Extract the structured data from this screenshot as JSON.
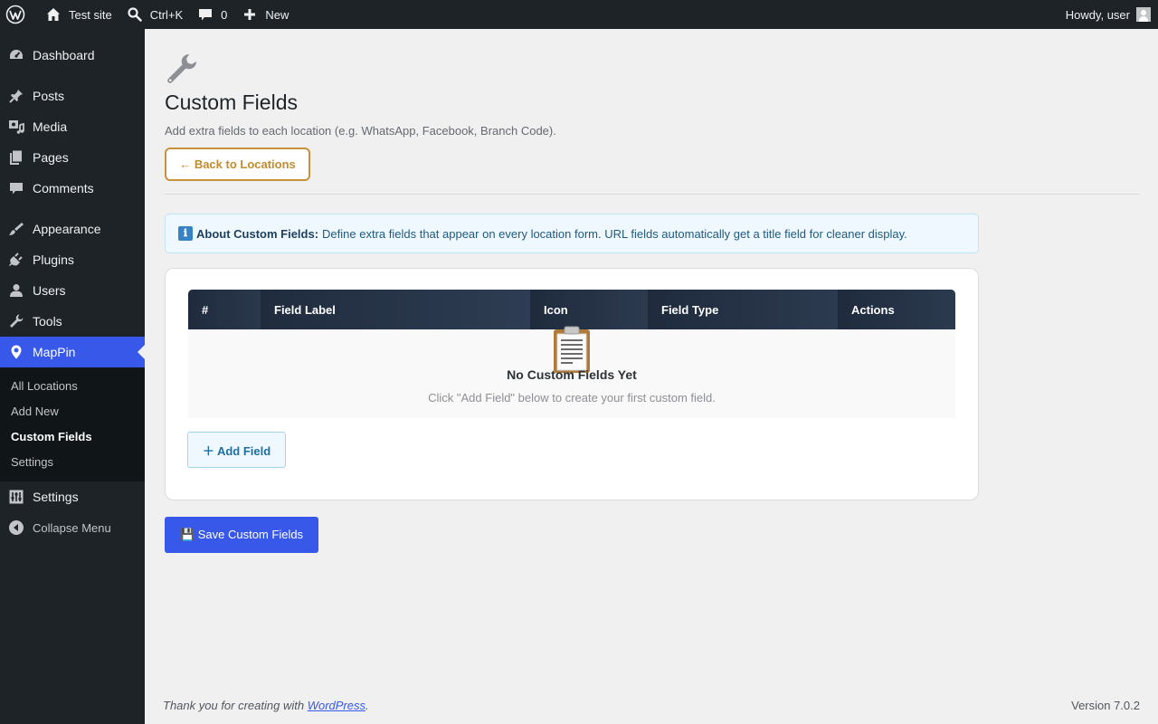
{
  "adminbar": {
    "site_name": "Test site",
    "search_shortcut": "Ctrl+K",
    "comments_count": "0",
    "new_label": "New",
    "howdy": "Howdy, user"
  },
  "sidebar": {
    "items": [
      {
        "label": "Dashboard",
        "icon": "dashboard-icon"
      },
      {
        "label": "Posts",
        "icon": "pin-icon"
      },
      {
        "label": "Media",
        "icon": "media-icon"
      },
      {
        "label": "Pages",
        "icon": "pages-icon"
      },
      {
        "label": "Comments",
        "icon": "comment-icon"
      },
      {
        "label": "Appearance",
        "icon": "brush-icon"
      },
      {
        "label": "Plugins",
        "icon": "plug-icon"
      },
      {
        "label": "Users",
        "icon": "user-icon"
      },
      {
        "label": "Tools",
        "icon": "wrench-icon"
      },
      {
        "label": "MapPin",
        "icon": "map-pin-icon"
      },
      {
        "label": "Settings",
        "icon": "sliders-icon"
      }
    ],
    "submenu": [
      "All Locations",
      "Add New",
      "Custom Fields",
      "Settings"
    ],
    "collapse_label": "Collapse Menu"
  },
  "main": {
    "title": "Custom Fields",
    "subtitle": "Add extra fields to each location (e.g. WhatsApp, Facebook, Branch Code).",
    "back_label": "← Back to Locations",
    "notice_icon": "ℹ",
    "notice_bold": "About Custom Fields:",
    "notice_text": "Define extra fields that appear on every location form. URL fields automatically get a title field for cleaner display.",
    "table": {
      "columns": [
        "#",
        "Field Label",
        "Icon",
        "Field Type",
        "Actions"
      ],
      "empty_title": "No Custom Fields Yet",
      "empty_sub": "Click \"Add Field\" below to create your first custom field."
    },
    "add_field_label": "＋ Add Field",
    "save_label": "💾 Save Custom Fields"
  },
  "footer": {
    "thanks_prefix": "Thank you for creating with ",
    "thanks_link": "WordPress",
    "thanks_suffix": ".",
    "version": "Version 7.0.2"
  },
  "colors": {
    "accent": "#3858e9",
    "adminbar_bg": "#1d2327",
    "back_button": "#c9913a"
  }
}
